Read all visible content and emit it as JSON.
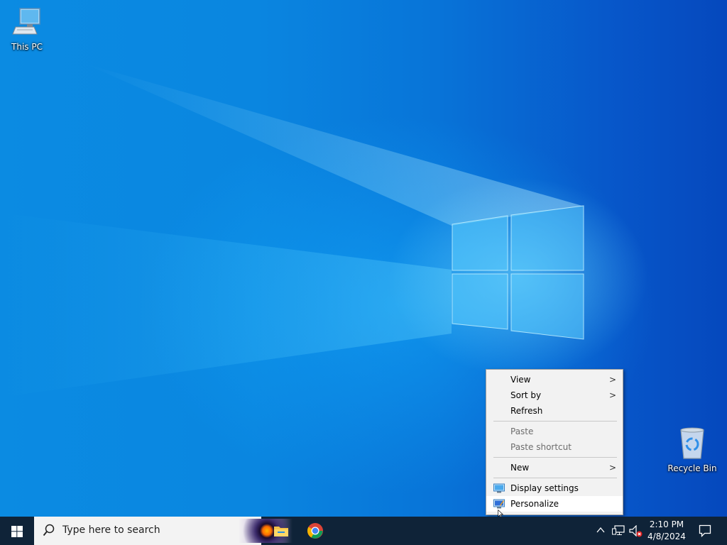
{
  "desktop": {
    "icons": [
      {
        "label": "This PC",
        "icon": "computer-icon"
      },
      {
        "label": "Recycle Bin",
        "icon": "recycle-bin-icon"
      }
    ]
  },
  "context_menu": {
    "items": {
      "view": "View",
      "sort_by": "Sort by",
      "refresh": "Refresh",
      "paste": "Paste",
      "paste_shortcut": "Paste shortcut",
      "new": "New",
      "display_settings": "Display settings",
      "personalize": "Personalize"
    },
    "submenu_arrow": ">"
  },
  "taskbar": {
    "start_icon": "windows-logo-icon",
    "search_placeholder": "Type here to search",
    "pinned": [
      "file-explorer-icon",
      "chrome-icon"
    ],
    "tray_icons": [
      "chevron-up-icon",
      "network-icon",
      "volume-muted-icon"
    ],
    "time": "2:10 PM",
    "date": "4/8/2024",
    "notification_icon": "notification-icon"
  },
  "colors": {
    "taskbar_bg": "#0f2338",
    "desktop_accent": "#0a86e0",
    "menu_bg": "#f2f2f2"
  }
}
